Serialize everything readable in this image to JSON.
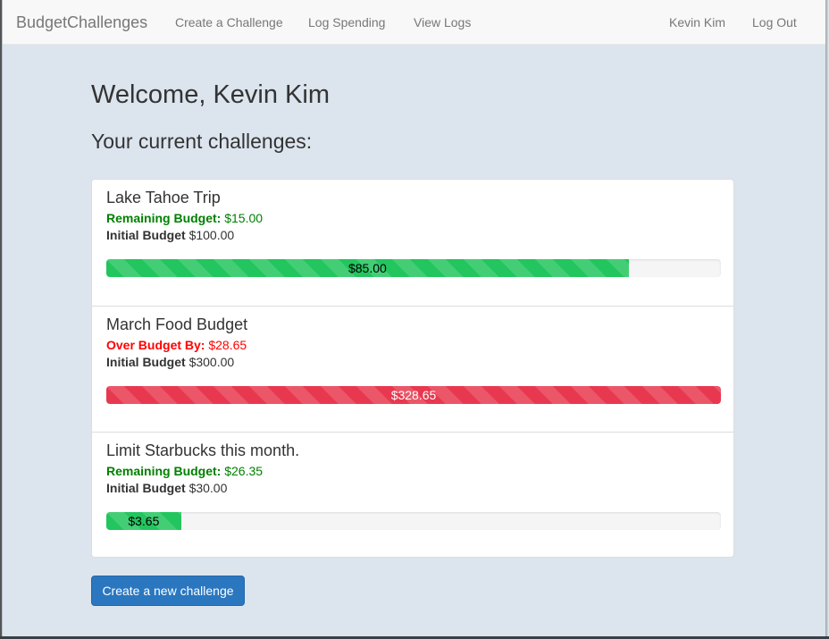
{
  "navbar": {
    "brand": "BudgetChallenges",
    "links": [
      "Create a Challenge",
      "Log Spending",
      "View Logs"
    ],
    "user_name": "Kevin Kim",
    "logout": "Log Out"
  },
  "main": {
    "welcome": "Welcome, Kevin Kim",
    "subheading": "Your current challenges:",
    "create_button": "Create a new challenge"
  },
  "challenges": [
    {
      "title": "Lake Tahoe Trip",
      "status_label": "Remaining Budget:",
      "status_value": "$15.00",
      "status": "remaining",
      "initial_label": "Initial Budget",
      "initial_value": "$100.00",
      "bar_label": "$85.00",
      "bar_fraction": 0.85
    },
    {
      "title": "March Food Budget",
      "status_label": "Over Budget By:",
      "status_value": "$28.65",
      "status": "over",
      "initial_label": "Initial Budget",
      "initial_value": "$300.00",
      "bar_label": "$328.65",
      "bar_fraction": 1.0
    },
    {
      "title": "Limit Starbucks this month.",
      "status_label": "Remaining Budget:",
      "status_value": "$26.35",
      "status": "remaining",
      "initial_label": "Initial Budget",
      "initial_value": "$30.00",
      "bar_label": "$3.65",
      "bar_fraction": 0.1217
    }
  ],
  "colors": {
    "remaining": "#008000",
    "over": "#ff0000",
    "bar_green": "#22c55e",
    "bar_red": "#e8384f",
    "primary_button": "#2a77c0"
  }
}
